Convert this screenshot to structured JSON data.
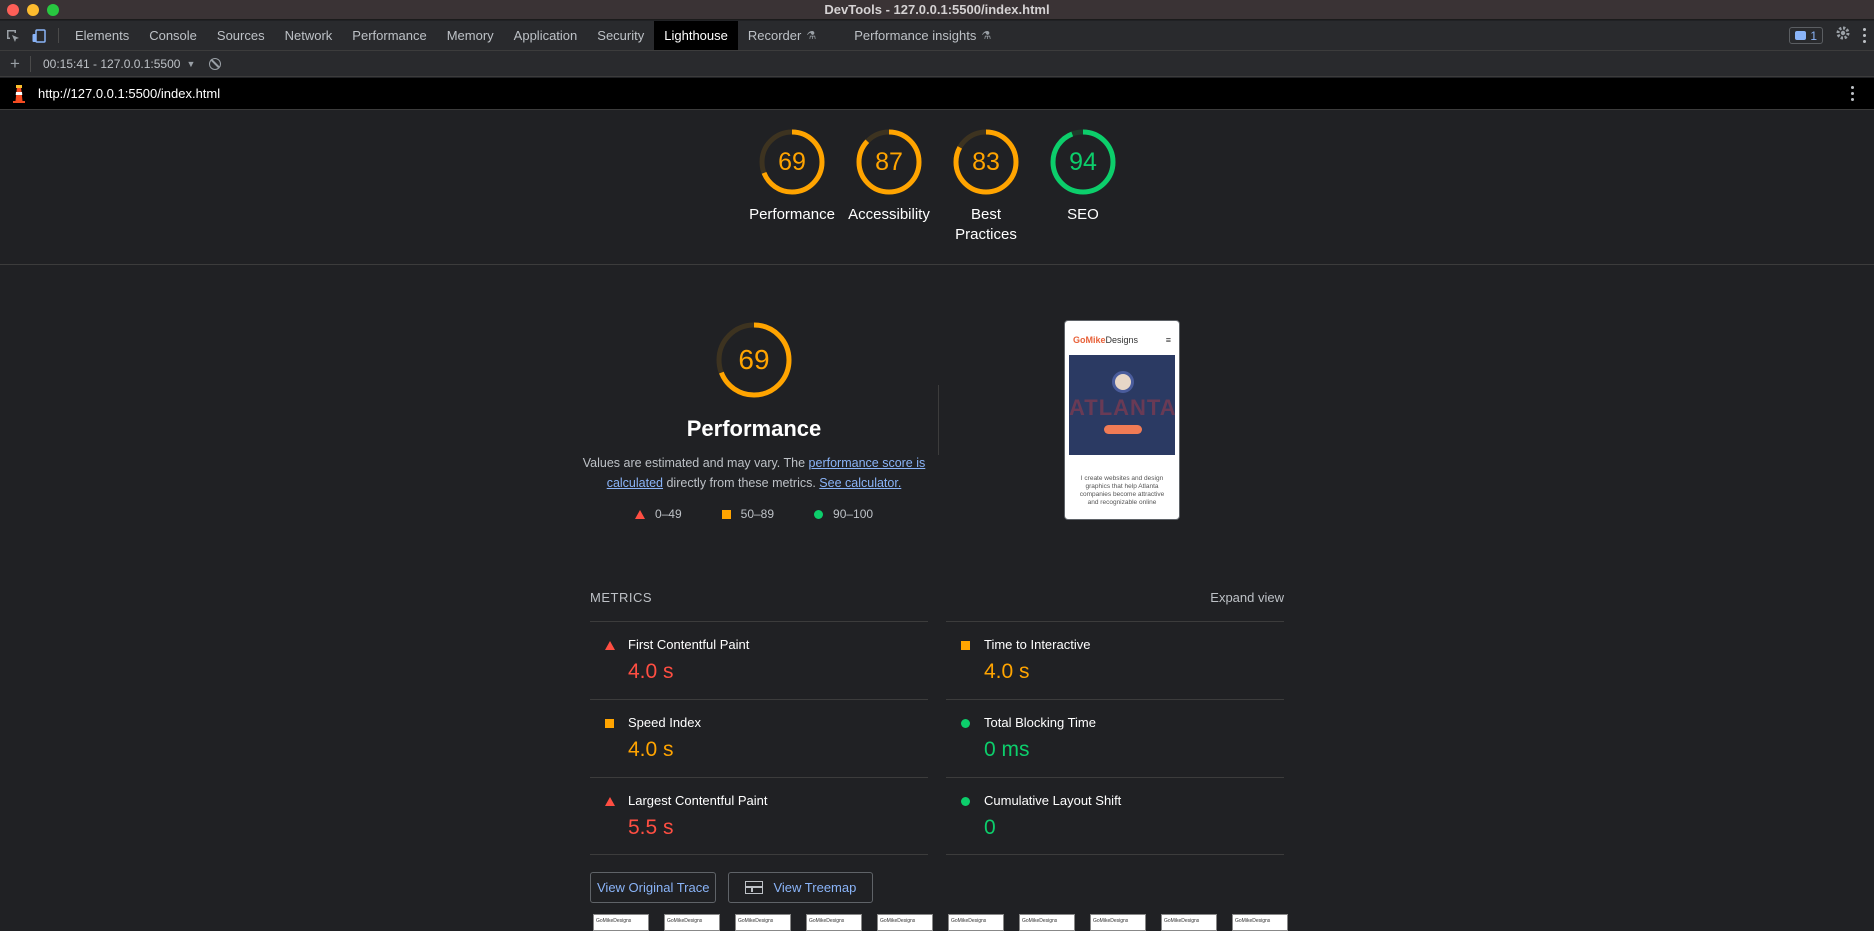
{
  "window": {
    "title": "DevTools - 127.0.0.1:5500/index.html"
  },
  "tabs": [
    {
      "label": "Elements"
    },
    {
      "label": "Console"
    },
    {
      "label": "Sources"
    },
    {
      "label": "Network"
    },
    {
      "label": "Performance"
    },
    {
      "label": "Memory"
    },
    {
      "label": "Application"
    },
    {
      "label": "Security"
    },
    {
      "label": "Lighthouse",
      "active": true
    },
    {
      "label": "Recorder"
    },
    {
      "label": "Performance insights"
    }
  ],
  "issues_count": "1",
  "toolbar": {
    "report_label": "00:15:41 - 127.0.0.1:5500",
    "add_label": "+"
  },
  "url": "http://127.0.0.1:5500/index.html",
  "categories": [
    {
      "label": "Performance",
      "score": 69,
      "color": "#ffa400",
      "track": "#3d3320"
    },
    {
      "label": "Accessibility",
      "score": 87,
      "color": "#ffa400",
      "track": "#3d3320"
    },
    {
      "label": "Best Practices",
      "score": 83,
      "color": "#ffa400",
      "track": "#3d3320"
    },
    {
      "label": "SEO",
      "score": 94,
      "color": "#0cce6b",
      "track": "#1e3a2a"
    }
  ],
  "performance": {
    "score": 69,
    "title": "Performance",
    "desc_pre": "Values are estimated and may vary. The ",
    "desc_link1": "performance score is calculated",
    "desc_mid": " directly from these metrics. ",
    "desc_link2": "See calculator.",
    "legend": [
      {
        "label": "0–49"
      },
      {
        "label": "50–89"
      },
      {
        "label": "90–100"
      }
    ]
  },
  "thumbnail": {
    "brand_a": "GoMike",
    "brand_b": "Designs",
    "hero_text": "ATLANTA",
    "body": "I create websites and design graphics that help Atlanta companies become attractive and recognizable online"
  },
  "metrics": {
    "title": "METRICS",
    "expand_label": "Expand view",
    "items": [
      {
        "name": "First Contentful Paint",
        "value": "4.0 s",
        "rating": "red"
      },
      {
        "name": "Time to Interactive",
        "value": "4.0 s",
        "rating": "orange"
      },
      {
        "name": "Speed Index",
        "value": "4.0 s",
        "rating": "orange"
      },
      {
        "name": "Total Blocking Time",
        "value": "0 ms",
        "rating": "green"
      },
      {
        "name": "Largest Contentful Paint",
        "value": "5.5 s",
        "rating": "red"
      },
      {
        "name": "Cumulative Layout Shift",
        "value": "0",
        "rating": "green"
      }
    ]
  },
  "buttons": {
    "view_trace": "View Original Trace",
    "view_treemap": "View Treemap"
  },
  "filmstrip": {
    "frame_label": "GoMikeDesigns",
    "count": 10
  }
}
